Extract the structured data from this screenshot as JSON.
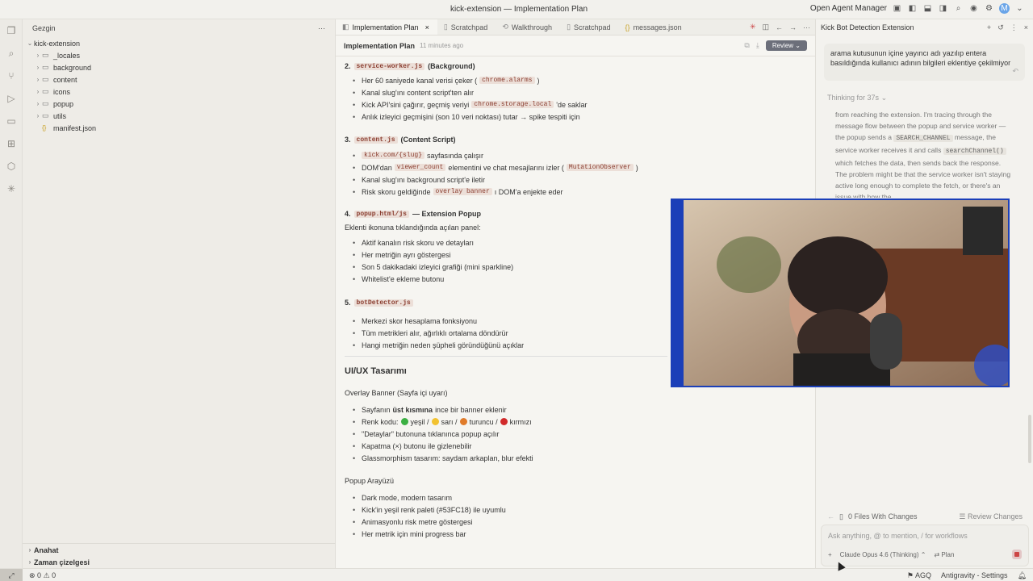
{
  "window": {
    "title": "kick-extension — Implementation Plan",
    "agent_manager_label": "Open Agent Manager"
  },
  "explorer": {
    "header": "Gezgin",
    "root": "kick-extension",
    "items": [
      {
        "label": "_locales",
        "kind": "folder"
      },
      {
        "label": "background",
        "kind": "folder"
      },
      {
        "label": "content",
        "kind": "folder"
      },
      {
        "label": "icons",
        "kind": "folder"
      },
      {
        "label": "popup",
        "kind": "folder"
      },
      {
        "label": "utils",
        "kind": "folder"
      },
      {
        "label": "manifest.json",
        "kind": "file"
      }
    ],
    "outline_label": "Anahat",
    "timeline_label": "Zaman çizelgesi"
  },
  "tabs": [
    {
      "label": "Implementation Plan",
      "active": true
    },
    {
      "label": "Scratchpad",
      "active": false
    },
    {
      "label": "Walkthrough",
      "active": false
    },
    {
      "label": "Scratchpad",
      "active": false
    },
    {
      "label": "messages.json",
      "active": false
    }
  ],
  "plan": {
    "title": "Implementation Plan",
    "time": "11 minutes ago",
    "review_label": "Review",
    "sec2": {
      "num": "2.",
      "code": "service-worker.js",
      "suffix": "(Background)"
    },
    "sec2_items": {
      "a1": "Her 60 saniyede kanal verisi çeker (",
      "a_code": "chrome.alarms",
      "a2": ")",
      "b": "Kanal slug'ını content script'ten alır",
      "c1": "Kick API'sini çağırır, geçmiş veriyi",
      "c_code": "chrome.storage.local",
      "c2": "'de saklar",
      "d": "Anlık izleyici geçmişini (son 10 veri noktası) tutar → spike tespiti için"
    },
    "sec3": {
      "num": "3.",
      "code": "content.js",
      "suffix": "(Content Script)"
    },
    "sec3_items": {
      "a_code": "kick.com/{slug}",
      "a2": "sayfasında çalışır",
      "b1": "DOM'dan",
      "b_code": "viewer_count",
      "b2": "elementini ve chat mesajlarını izler (",
      "b_code2": "MutationObserver",
      "b3": ")",
      "c": "Kanal slug'ını background script'e iletir",
      "d1": "Risk skoru geldiğinde",
      "d_code": "overlay banner",
      "d2": "ı DOM'a enjekte eder"
    },
    "sec4": {
      "num": "4.",
      "code": "popup.html/js",
      "suffix": "— Extension Popup"
    },
    "sec4_intro": "Eklenti ikonuna tıklandığında açılan panel:",
    "sec4_items": [
      "Aktif kanalın risk skoru ve detayları",
      "Her metriğin ayrı göstergesi",
      "Son 5 dakikadaki izleyici grafiği (mini sparkline)",
      "Whitelist'e ekleme butonu"
    ],
    "sec5": {
      "num": "5.",
      "code": "botDetector.js"
    },
    "sec5_items": [
      "Merkezi skor hesaplama fonksiyonu",
      "Tüm metrikleri alır, ağırlıklı ortalama döndürür",
      "Hangi metriğin neden şüpheli göründüğünü açıklar"
    ],
    "uiux_title": "UI/UX Tasarımı",
    "overlay_title": "Overlay Banner (Sayfa içi uyarı)",
    "overlay_items": {
      "a1": "Sayfanın",
      "a_bold": "üst kısmına",
      "a2": "ince bir banner eklenir",
      "b_prefix": "Renk kodu:",
      "b_green": "yeşil /",
      "b_yellow": "sarı /",
      "b_orange": "turuncu /",
      "b_red": "kırmızı",
      "c": "\"Detaylar\" butonuna tıklanınca popup açılır",
      "d": "Kapatma (×) butonu ile gizlenebilir",
      "e": "Glassmorphism tasarım: saydam arkaplan, blur efekti"
    },
    "popup_title": "Popup Arayüzü",
    "popup_items": [
      "Dark mode, modern tasarım",
      "Kick'in yeşil renk paleti (#53FC18) ile uyumlu",
      "Animasyonlu risk metre göstergesi",
      "Her metrik için mini progress bar"
    ]
  },
  "agent": {
    "title": "Kick Bot Detection Extension",
    "user_message": "arama kutusunun içine yayıncı adı yazılıp entera basıldığında kullanıcı adının bilgileri eklentiye çekilmiyor",
    "thinking_label": "Thinking for 37s",
    "think": {
      "t1": "from reaching the extension. I'm tracing through the message flow between the popup and service worker —the popup sends a",
      "code1": "SEARCH_CHANNEL",
      "t2": "message, the service worker receives it and calls",
      "code2": "searchChannel()",
      "t3": "which fetches the data, then sends back the response. The problem might be that the service worker isn't staying active long enough to complete the fetch, or there's an issue with how the"
    },
    "files_label": "0 Files With Changes",
    "review_changes_label": "Review Changes",
    "input_placeholder": "Ask anything, @ to mention, / for workflows",
    "model_label": "Claude Opus 4.6 (Thinking)",
    "mode_label": "Plan"
  },
  "status": {
    "errors": "0",
    "warnings": "0",
    "agq": "AGQ",
    "settings": "Antigravity - Settings"
  },
  "colors": {
    "green": "#3cb043",
    "yellow": "#f2c230",
    "orange": "#e07b2a",
    "red": "#d12a2a",
    "webcam_border": "#1b3fb8"
  }
}
